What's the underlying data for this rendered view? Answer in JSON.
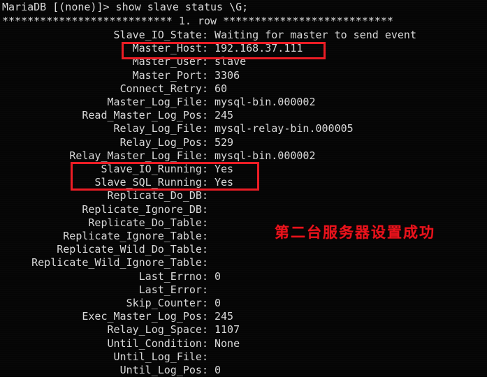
{
  "terminal": {
    "background_color": "#050505",
    "text_color": "#d9d9d9",
    "accent_color": "#ec1c24",
    "prompt_line": "MariaDB [(none)]> show slave status \\G;",
    "row_banner": "*************************** 1. row ***************************",
    "rows": [
      {
        "label": "Slave_IO_State:",
        "value": "Waiting for master to send event"
      },
      {
        "label": "Master_Host:",
        "value": "192.168.37.111"
      },
      {
        "label": "Master_User:",
        "value": "slave"
      },
      {
        "label": "Master_Port:",
        "value": "3306"
      },
      {
        "label": "Connect_Retry:",
        "value": "60"
      },
      {
        "label": "Master_Log_File:",
        "value": "mysql-bin.000002"
      },
      {
        "label": "Read_Master_Log_Pos:",
        "value": "245"
      },
      {
        "label": "Relay_Log_File:",
        "value": "mysql-relay-bin.000005"
      },
      {
        "label": "Relay_Log_Pos:",
        "value": "529"
      },
      {
        "label": "Relay_Master_Log_File:",
        "value": "mysql-bin.000002"
      },
      {
        "label": "Slave_IO_Running:",
        "value": "Yes"
      },
      {
        "label": "Slave_SQL_Running:",
        "value": "Yes"
      },
      {
        "label": "Replicate_Do_DB:",
        "value": ""
      },
      {
        "label": "Replicate_Ignore_DB:",
        "value": ""
      },
      {
        "label": "Replicate_Do_Table:",
        "value": ""
      },
      {
        "label": "Replicate_Ignore_Table:",
        "value": ""
      },
      {
        "label": "Replicate_Wild_Do_Table:",
        "value": ""
      },
      {
        "label": "Replicate_Wild_Ignore_Table:",
        "value": ""
      },
      {
        "label": "Last_Errno:",
        "value": "0"
      },
      {
        "label": "Last_Error:",
        "value": ""
      },
      {
        "label": "Skip_Counter:",
        "value": "0"
      },
      {
        "label": "Exec_Master_Log_Pos:",
        "value": "245"
      },
      {
        "label": "Relay_Log_Space:",
        "value": "1107"
      },
      {
        "label": "Until_Condition:",
        "value": "None"
      },
      {
        "label": "Until_Log_File:",
        "value": ""
      },
      {
        "label": "Until_Log_Pos:",
        "value": "0"
      }
    ]
  },
  "annotations": {
    "chinese_note": "第二台服务器设置成功",
    "highlight_master_host_label": "Master_Host highlight",
    "highlight_slave_running_label": "Slave running highlight"
  }
}
